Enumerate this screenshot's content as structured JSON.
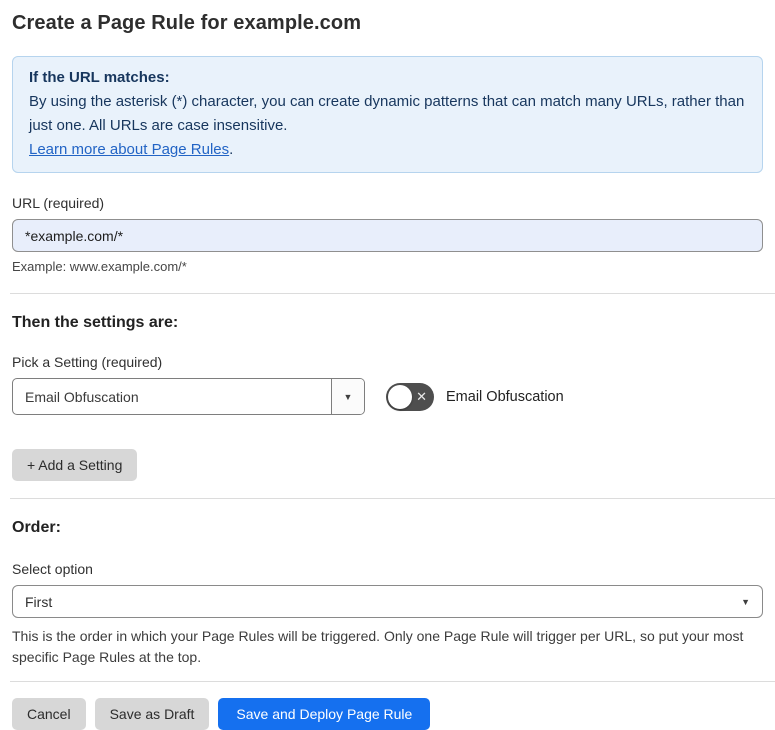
{
  "page": {
    "title": "Create a Page Rule for example.com"
  },
  "info_box": {
    "heading": "If the URL matches:",
    "body": "By using the asterisk (*) character, you can create dynamic patterns that can match many URLs, rather than just one. All URLs are case insensitive.",
    "link_label": "Learn more about Page Rules",
    "link_suffix": "."
  },
  "url_section": {
    "label": "URL (required)",
    "value": "*example.com/*",
    "example": "Example: www.example.com/*"
  },
  "settings_section": {
    "heading": "Then the settings are:",
    "picker_label": "Pick a Setting (required)",
    "selected_setting": "Email Obfuscation",
    "toggle_label": "Email Obfuscation",
    "toggle_state": "off",
    "add_setting_label": "+ Add a Setting"
  },
  "order_section": {
    "heading": "Order:",
    "select_label": "Select option",
    "selected_option": "First",
    "description": "This is the order in which your Page Rules will be triggered. Only one Page Rule will trigger per URL, so put your most specific Page Rules at the top."
  },
  "footer": {
    "cancel_label": "Cancel",
    "save_draft_label": "Save as Draft",
    "save_deploy_label": "Save and Deploy Page Rule"
  },
  "icons": {
    "chevron_down": "▼",
    "toggle_off_cross": "✕"
  },
  "colors": {
    "info_box_bg": "#e9f2fb",
    "info_box_border": "#b6d4ee",
    "info_text": "#17365d",
    "link_blue": "#2264c5",
    "url_input_bg": "#e8eefb",
    "toggle_off_bg": "#4e4e4e",
    "gray_button_bg": "#d7d7d7",
    "primary_button_bg": "#1570ef"
  }
}
